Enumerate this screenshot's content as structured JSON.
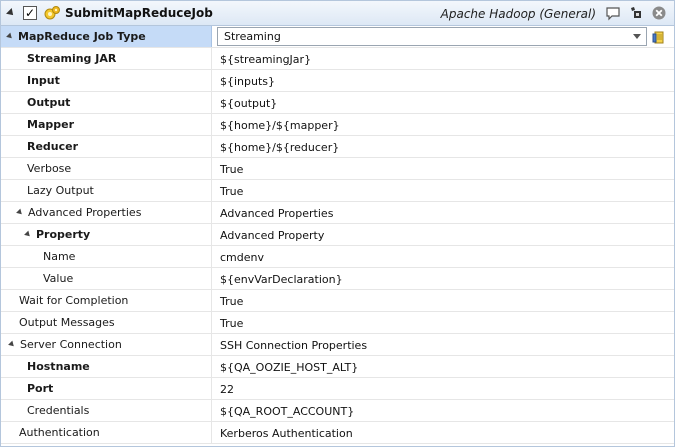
{
  "header": {
    "title": "SubmitMapReduceJob",
    "service": "Apache Hadoop (General)",
    "checked": true
  },
  "job_type": {
    "label": "MapReduce Job Type",
    "value": "Streaming"
  },
  "rows": [
    {
      "label": "Streaming JAR",
      "value": "${streamingJar}",
      "indent": 1,
      "bold": true,
      "expand": false
    },
    {
      "label": "Input",
      "value": "${inputs}",
      "indent": 1,
      "bold": true,
      "expand": false
    },
    {
      "label": "Output",
      "value": "${output}",
      "indent": 1,
      "bold": true,
      "expand": false
    },
    {
      "label": "Mapper",
      "value": "${home}/${mapper}",
      "indent": 1,
      "bold": true,
      "expand": false
    },
    {
      "label": "Reducer",
      "value": "${home}/${reducer}",
      "indent": 1,
      "bold": true,
      "expand": false
    },
    {
      "label": "Verbose",
      "value": "True",
      "indent": 1,
      "bold": false,
      "expand": false
    },
    {
      "label": "Lazy Output",
      "value": "True",
      "indent": 1,
      "bold": false,
      "expand": false
    },
    {
      "label": "Advanced Properties",
      "value": "Advanced Properties",
      "indent": 1,
      "bold": false,
      "expand": true
    },
    {
      "label": "Property",
      "value": "Advanced Property",
      "indent": 2,
      "bold": true,
      "expand": true
    },
    {
      "label": "Name",
      "value": "cmdenv",
      "indent": 3,
      "bold": false,
      "expand": false
    },
    {
      "label": "Value",
      "value": "${envVarDeclaration}",
      "indent": 3,
      "bold": false,
      "expand": false
    },
    {
      "label": "Wait for Completion",
      "value": "True",
      "indent": 0,
      "bold": false,
      "expand": false
    },
    {
      "label": "Output Messages",
      "value": "True",
      "indent": 0,
      "bold": false,
      "expand": false
    },
    {
      "label": "Server Connection",
      "value": "SSH Connection Properties",
      "indent": 0,
      "bold": false,
      "expand": true
    },
    {
      "label": "Hostname",
      "value": "${QA_OOZIE_HOST_ALT}",
      "indent": 1,
      "bold": true,
      "expand": false
    },
    {
      "label": "Port",
      "value": "22",
      "indent": 1,
      "bold": true,
      "expand": false
    },
    {
      "label": "Credentials",
      "value": "${QA_ROOT_ACCOUNT}",
      "indent": 1,
      "bold": false,
      "expand": false
    },
    {
      "label": "Authentication",
      "value": "Kerberos Authentication",
      "indent": 0,
      "bold": false,
      "expand": false
    }
  ],
  "icons": {
    "collapse": "chevron-down-icon",
    "step": "gear-icon",
    "comment": "comment-icon",
    "save": "save-icon",
    "close": "close-icon",
    "lookup": "variable-lookup-icon"
  },
  "colors": {
    "selected_row": "#c5dbf7",
    "header_bg": "#dde8f5",
    "border": "#b4c6dc"
  }
}
